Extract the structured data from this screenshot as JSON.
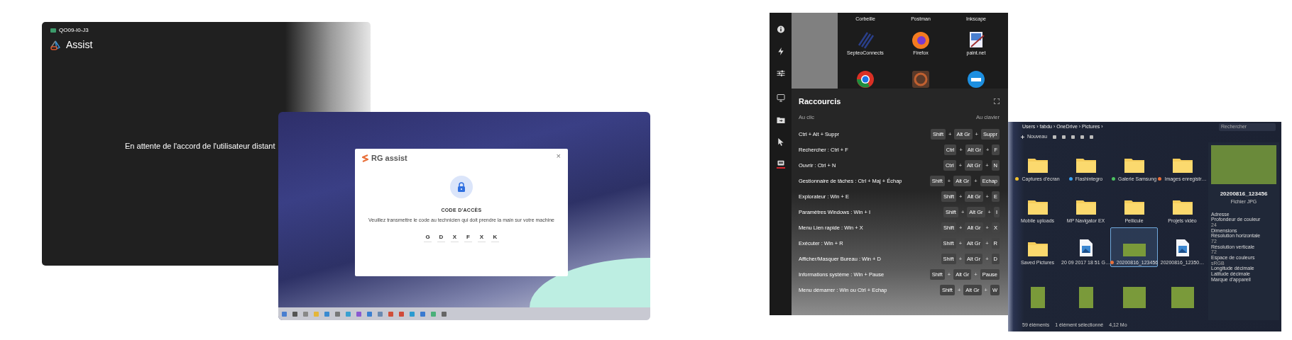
{
  "remote_window": {
    "session_id": "QO09-I0-J3",
    "app_name": "Assist",
    "message": "En attente de l'accord de l'utilisateur distant"
  },
  "client_desktop": {
    "dialog": {
      "logo": "RG assist",
      "close": "×",
      "title": "CODE D'ACCÈS",
      "instructions": "Veuillez transmettre le code au technicien qui doit prendre la main sur votre machine",
      "code": [
        "G",
        "D",
        "X",
        "F",
        "X",
        "K"
      ]
    }
  },
  "control_panel": {
    "sidebar": [
      {
        "kind": "info",
        "selected": false
      },
      {
        "kind": "bolt",
        "selected": false
      },
      {
        "kind": "sliders",
        "selected": false
      },
      {
        "kind": "monitor",
        "selected": false
      },
      {
        "kind": "folder",
        "selected": false
      },
      {
        "kind": "pointer",
        "selected": false
      },
      {
        "kind": "keyboard",
        "selected": true
      }
    ],
    "desktop_icons": [
      {
        "kind": "cut",
        "label": "Corbeille"
      },
      {
        "kind": "cut",
        "label": "Postman"
      },
      {
        "kind": "cut",
        "label": "Inkscape"
      },
      {
        "kind": "stripes",
        "label": "SepteoConnects"
      },
      {
        "kind": "firefox",
        "label": "Firefox"
      },
      {
        "kind": "paint",
        "label": "paint.net"
      },
      {
        "kind": "chrome"
      },
      {
        "kind": "game"
      },
      {
        "kind": "docker"
      }
    ],
    "shortcuts": {
      "title": "Raccourcis",
      "left_header": "Au clic",
      "right_header": "Au clavier",
      "rows": [
        {
          "action": "Ctrl + Alt + Suppr",
          "keys": [
            "Shift",
            "+",
            "Alt Gr",
            "+",
            "Suppr"
          ]
        },
        {
          "action": "Rechercher : Ctrl + F",
          "keys": [
            "Ctrl",
            "+",
            "Alt Gr",
            "+",
            "F"
          ]
        },
        {
          "action": "Ouvrir : Ctrl + N",
          "keys": [
            "Ctrl",
            "+",
            "Alt Gr",
            "+",
            "N"
          ]
        },
        {
          "action": "Gestionnaire de tâches : Ctrl + Maj + Échap",
          "keys": [
            "Shift",
            "+",
            "Alt Gr",
            "+",
            "Echap"
          ]
        },
        {
          "action": "Explorateur : Win + E",
          "keys": [
            "Shift",
            "+",
            "Alt Gr",
            "+",
            "E"
          ]
        },
        {
          "action": "Paramètres Windows : Win + I",
          "keys": [
            "Shift",
            "+",
            "Alt Gr",
            "+",
            "I"
          ]
        },
        {
          "action": "Menu Lien rapide : Win + X",
          "keys": [
            "Shift",
            "+",
            "Alt Gr",
            "+",
            "X"
          ]
        },
        {
          "action": "Exécuter : Win + R",
          "keys": [
            "Shift",
            "+",
            "Alt Gr",
            "+",
            "R"
          ]
        },
        {
          "action": "Afficher/Masquer Bureau : Win + D",
          "keys": [
            "Shift",
            "+",
            "Alt Gr",
            "+",
            "D"
          ]
        },
        {
          "action": "Informations système : Win + Pause",
          "keys": [
            "Shift",
            "+",
            "Alt Gr",
            "+",
            "Pause"
          ]
        },
        {
          "action": "Menu démarrer : Win ou Ctrl + Echap",
          "keys": [
            "Shift",
            "+",
            "Alt Gr",
            "+",
            "W"
          ]
        }
      ]
    }
  },
  "file_explorer": {
    "breadcrumb": "Users › fabdu › OneDrive › Pictures ›",
    "search_placeholder": "Rechercher",
    "new_button": "Nouveau",
    "items": [
      {
        "kind": "folder",
        "label": "Captures d'écran",
        "color": "#f2c230",
        "selected": false
      },
      {
        "kind": "folder",
        "label": "Flashintegro",
        "color": "#3aa0f0",
        "selected": false
      },
      {
        "kind": "folder",
        "label": "Galerie Samsung",
        "color": "#4cc060",
        "selected": false
      },
      {
        "kind": "folder",
        "label": "Images enregistr…",
        "color": "#e8703a",
        "selected": false
      },
      {
        "kind": "folder",
        "label": "Mobile uploads",
        "selected": false
      },
      {
        "kind": "folder",
        "label": "MP Navigator EX",
        "selected": false
      },
      {
        "kind": "folder",
        "label": "Pellicule",
        "selected": false
      },
      {
        "kind": "folder",
        "label": "Projets vidéo",
        "selected": false
      },
      {
        "kind": "folder",
        "label": "Saved Pictures",
        "selected": false
      },
      {
        "kind": "image",
        "label": "20 09 2017 18 51 G…",
        "selected": false
      },
      {
        "kind": "photo",
        "label": "20200816_123456",
        "color": "#e8703a",
        "selected": true
      },
      {
        "kind": "image",
        "label": "20200816_12350…",
        "selected": false
      },
      {
        "kind": "photo",
        "selected": false
      },
      {
        "kind": "photo",
        "selected": false
      },
      {
        "kind": "photo",
        "selected": false
      },
      {
        "kind": "photo",
        "selected": false
      }
    ],
    "details": {
      "name": "20200816_123456",
      "type": "Fichier JPG",
      "properties": [
        {
          "label": "Adresse"
        },
        {
          "label": "Profondeur de couleur",
          "value": "24"
        },
        {
          "label": "Dimensions"
        },
        {
          "label": "Résolution horizontale",
          "value": "72"
        },
        {
          "label": "Résolution verticale",
          "value": "72"
        },
        {
          "label": "Espace de couleurs",
          "value": "sRGB"
        },
        {
          "label": "Longitude décimale"
        },
        {
          "label": "Latitude décimale"
        },
        {
          "label": "Marque d'appareil"
        }
      ]
    },
    "status": [
      "59 éléments",
      "1 élément sélectionné",
      "4,12 Mo"
    ]
  }
}
